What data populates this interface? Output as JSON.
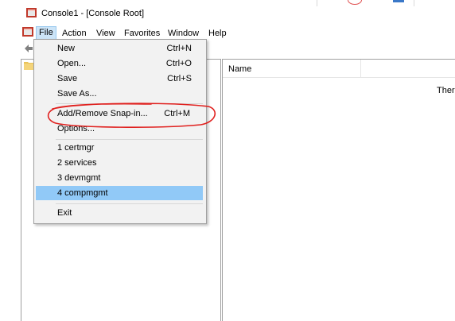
{
  "window": {
    "title": "Console1 - [Console Root]"
  },
  "menubar": {
    "items": [
      "File",
      "Action",
      "View",
      "Favorites",
      "Window",
      "Help"
    ]
  },
  "file_menu": {
    "items": [
      {
        "label": "New",
        "shortcut": "Ctrl+N"
      },
      {
        "label": "Open...",
        "shortcut": "Ctrl+O"
      },
      {
        "label": "Save",
        "shortcut": "Ctrl+S"
      },
      {
        "label": "Save As...",
        "shortcut": ""
      },
      {
        "label": "Add/Remove Snap-in...",
        "shortcut": "Ctrl+M"
      },
      {
        "label": "Options...",
        "shortcut": ""
      },
      {
        "label": "1 certmgr",
        "shortcut": ""
      },
      {
        "label": "2 services",
        "shortcut": ""
      },
      {
        "label": "3 devmgmt",
        "shortcut": ""
      },
      {
        "label": "4 compmgmt",
        "shortcut": ""
      },
      {
        "label": "Exit",
        "shortcut": ""
      }
    ],
    "highlighted": "4 compmgmt"
  },
  "details": {
    "column_name": "Name",
    "empty_message": "There"
  },
  "colors": {
    "highlight": "#91c9f7",
    "menu_bg": "#f2f2f2",
    "annotation": "#e0201e"
  },
  "icons": {
    "title": "mmc-console-icon",
    "app_menu": "mmc-console-icon",
    "back": "back-arrow-icon",
    "tree": "folder-icon"
  }
}
